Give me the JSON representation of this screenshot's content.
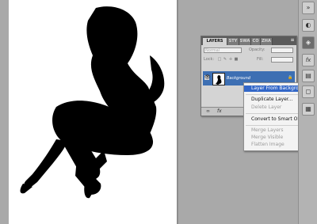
{
  "layers_panel": {
    "tabs": [
      "LAYERS",
      "STY",
      "SWA",
      "CO",
      "ZHA"
    ],
    "blend_mode": "Normal",
    "opacity_label": "Opacity:",
    "lock_label": "Lock:",
    "fill_label": "Fill:",
    "layer_name": "Background"
  },
  "context_menu": {
    "items": [
      {
        "label": "Layer From Background...",
        "state": "highlighted"
      },
      {
        "label": "Duplicate Layer...",
        "state": "enabled"
      },
      {
        "label": "Delete Layer",
        "state": "disabled"
      },
      {
        "label": "Convert to Smart Object",
        "state": "enabled"
      },
      {
        "label": "Merge Layers",
        "state": "disabled"
      },
      {
        "label": "Merge Visible",
        "state": "disabled"
      },
      {
        "label": "Flatten Image",
        "state": "disabled"
      }
    ]
  },
  "bottom_bar_icons": [
    "link-icon",
    "fx-icon"
  ],
  "dock_icons": [
    "double-arrow-icon",
    "color-icon",
    "swatches-icon",
    "layers-icon",
    "channels-icon",
    "paths-icon",
    "history-icon"
  ],
  "colors": {
    "selection": "#3d6fb3",
    "menu_highlight": "#3367c8",
    "workspace": "#a9a9a9"
  }
}
